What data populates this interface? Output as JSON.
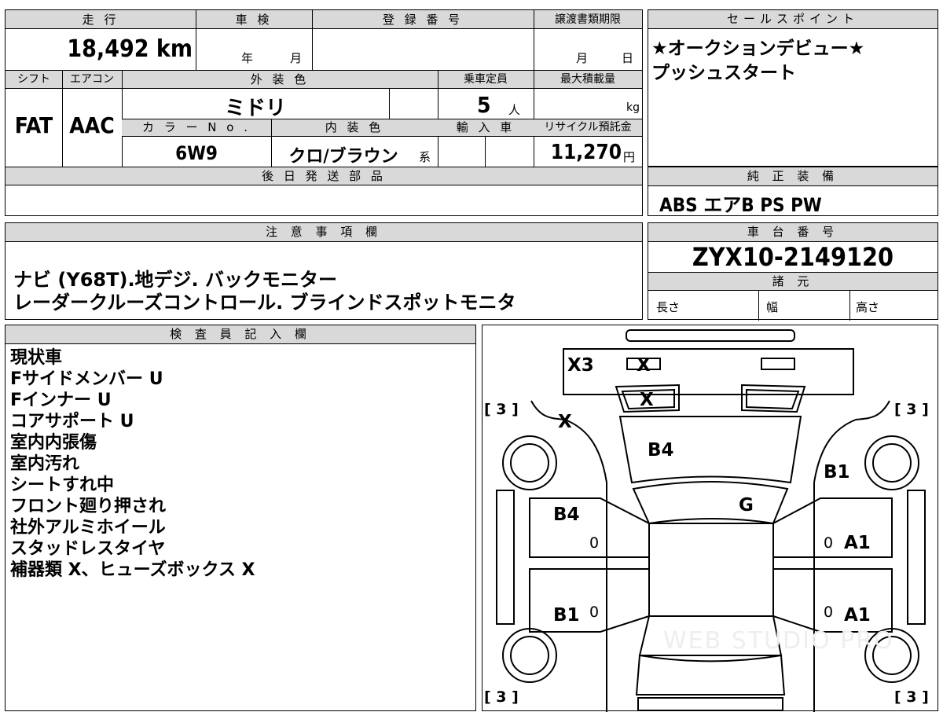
{
  "basic": {
    "mileage_label": "走 行",
    "mileage_value": "18,492",
    "mileage_unit": "km",
    "inspection_label": "車 検",
    "inspection_year": "年",
    "inspection_month": "月",
    "registration_label": "登 録 番 号",
    "transfer_label": "譲渡書類期限",
    "transfer_month": "月",
    "transfer_day": "日",
    "shift_label": "シフト",
    "shift_value": "FAT",
    "ac_label": "エアコン",
    "ac_value": "AAC",
    "exterior_color_label": "外 装 色",
    "exterior_color_value": "ミドリ",
    "capacity_label": "乗車定員",
    "capacity_value": "5",
    "capacity_unit": "人",
    "max_load_label": "最大積載量",
    "max_load_unit": "kg",
    "color_no_label": "カ ラ ー N o .",
    "color_no_value": "6W9",
    "interior_color_label": "内 装 色",
    "interior_color_value": "クロ/ブラウン",
    "interior_color_suffix": "系",
    "import_label": "輸 入 車",
    "recycle_label": "リサイクル預託金",
    "recycle_value": "11,270",
    "recycle_unit": "円",
    "later_parts_label": "後 日 発 送 部 品"
  },
  "sales": {
    "label": "セールスポイント",
    "lines": [
      "★オークションデビュー★",
      "プッシュスタート"
    ]
  },
  "equipment": {
    "label": "純 正 装 備",
    "value": "ABS エアB PS PW"
  },
  "notes": {
    "label": "注 意 事 項 欄",
    "lines": [
      "ナビ (Y68T).地デジ. バックモニター",
      "レーダークルーズコントロール. ブラインドスポットモニタ"
    ]
  },
  "chassis": {
    "label": "車 台 番 号",
    "value": "ZYX10-2149120",
    "specs_label": "諸 元",
    "length_label": "長さ",
    "width_label": "幅",
    "height_label": "高さ"
  },
  "inspector": {
    "label": "検 査 員 記 入 欄",
    "lines": [
      "現状車",
      "Fサイドメンバー U",
      "Fインナー U",
      "コアサポート U",
      "室内内張傷",
      "室内汚れ",
      "シートすれ中",
      "フロント廻り押され",
      "社外アルミホイール",
      "スタッドレスタイヤ",
      "補器類 X、ヒューズボックス X"
    ]
  },
  "diagram": {
    "marks": {
      "x3": "X3",
      "x_top": "X",
      "x_grille": "X",
      "x_left": "X",
      "b4_hood": "B4",
      "b1_rf": "B1",
      "g_glass": "G",
      "b4_lfdoor": "B4",
      "a1_rfdoor": "A1",
      "b1_lrdoor": "B1",
      "a1_rrdoor": "A1",
      "zero1": "0",
      "zero2": "0",
      "zero3": "0",
      "zero4": "0"
    },
    "tire_tl": "[ 3 ]",
    "tire_tr": "[ 3 ]",
    "tire_bl": "[ 3 ]",
    "tire_br": "[ 3 ]",
    "watermark": "WEB STUDIO PRO"
  }
}
